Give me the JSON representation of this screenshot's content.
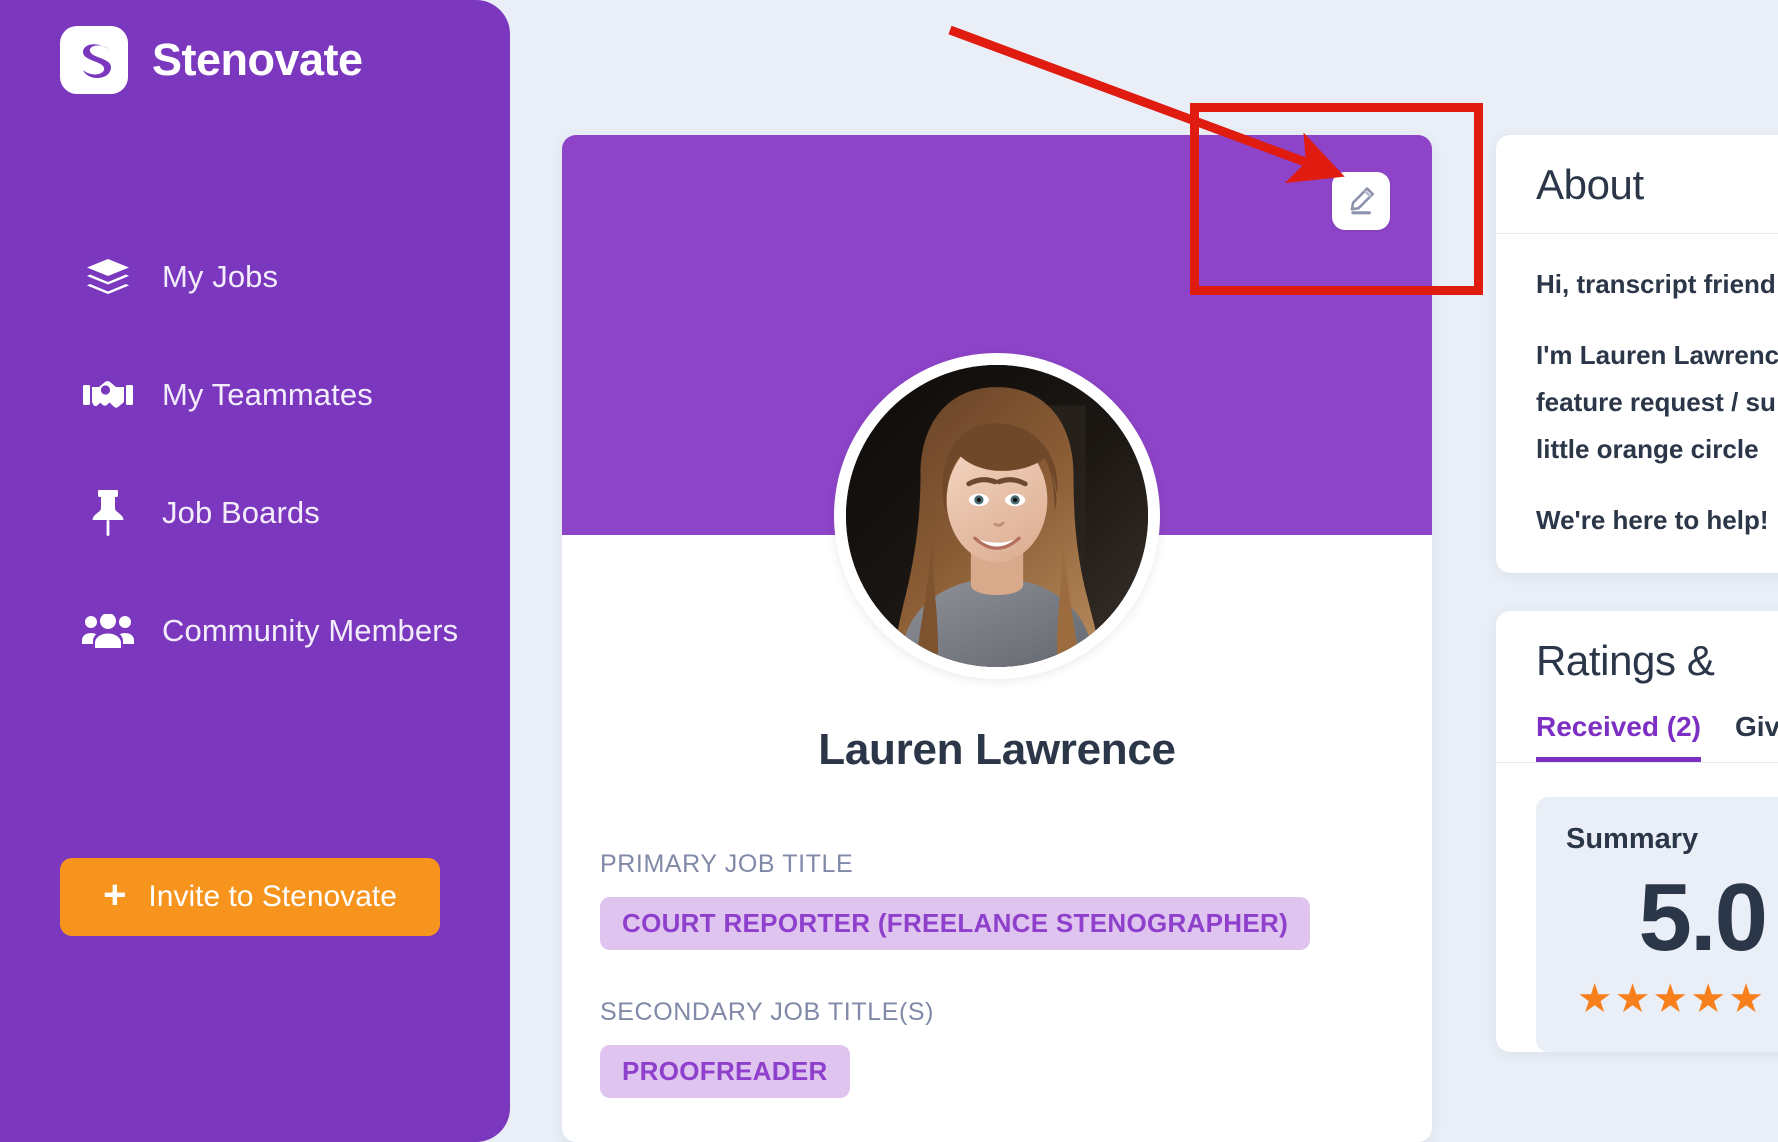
{
  "colors": {
    "sidebar_purple": "#7b38bf",
    "banner_purple": "#8e44c8",
    "accent_orange": "#f7941d",
    "background": "#eaeff7",
    "chip_bg": "#dfc4ef",
    "chip_text": "#8e3fcc",
    "annotation_red": "#e01b10",
    "text_dark": "#2b3648",
    "tab_active": "#7d2fc4",
    "star_orange": "#f7801d"
  },
  "sidebar": {
    "brand": {
      "name": "Stenovate",
      "logo_icon": "stenovate-s-logo"
    },
    "items": [
      {
        "label": "My Jobs",
        "icon": "layers-icon"
      },
      {
        "label": "My Teammates",
        "icon": "handshake-icon"
      },
      {
        "label": "Job Boards",
        "icon": "pin-icon"
      },
      {
        "label": "Community Members",
        "icon": "users-group-icon"
      }
    ],
    "invite_button": {
      "label": "Invite to Stenovate",
      "icon": "plus-icon"
    }
  },
  "profile": {
    "edit_button_icon": "pencil-edit-icon",
    "avatar_alt": "Lauren Lawrence profile photo",
    "name": "Lauren Lawrence",
    "fields": [
      {
        "label": "PRIMARY JOB TITLE",
        "chips": [
          "COURT REPORTER (FREELANCE STENOGRAPHER)"
        ]
      },
      {
        "label": "SECONDARY JOB TITLE(S)",
        "chips": [
          "PROOFREADER"
        ]
      }
    ]
  },
  "about_panel": {
    "title": "About",
    "paragraphs": [
      "Hi, transcript friend",
      "I'm Lauren Lawrence",
      "feature request / su",
      "little orange circle",
      "We're here to help!"
    ]
  },
  "ratings_panel": {
    "title": "Ratings &",
    "tabs": [
      {
        "label": "Received (2)",
        "active": true
      },
      {
        "label": "Giv",
        "active": false
      }
    ],
    "summary": {
      "label": "Summary",
      "score": "5.0",
      "stars": "★★★★★"
    }
  },
  "annotation": {
    "rect_color": "#e01b10",
    "arrow_color": "#e01b10",
    "target": "pencil-edit-icon"
  }
}
